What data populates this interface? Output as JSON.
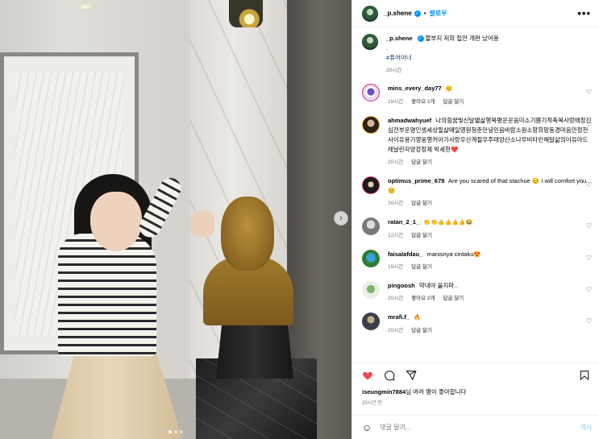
{
  "header": {
    "username": "_p.shene",
    "separator": "•",
    "follow_label": "팔로우",
    "more_label": "•••"
  },
  "caption": {
    "username": "_p.shene",
    "text": "할부지 저희 집안 개판 났어용",
    "line2": ".",
    "hashtag": "#퓨어아너",
    "time": "20시간"
  },
  "comments": [
    {
      "username": "mins_every_day77",
      "text": "🫡",
      "time": "19시간",
      "likes": "좋아요 1개",
      "reply": "답글 달기"
    },
    {
      "username": "ahmadwahyuef",
      "text": "나의힘꿈빛신달별삶행복평운운음미소기쁨기적축복사랑애정진심전부운명인생세상필살매일영원청춘안녕민음바람소원소망희망동경마음안정천사이유용기영웅행커아기사랑우산계절우주태양산소나무비타민해달삶의이유아드레날린자양강장제 박세현❤️",
      "time": "20시간",
      "likes": "",
      "reply": "답글 달기"
    },
    {
      "username": "optimus_prime_678",
      "text": "Are you scared of that stachue 😔 I will comfort you😊",
      "time": "20시간",
      "likes": "",
      "reply": "답글 달기"
    },
    {
      "username": "ratan_2_1_",
      "text": "👏👏👍👍👍👍😂",
      "time": "12시간",
      "likes": "",
      "reply": "답글 달기"
    },
    {
      "username": "faisalafdau_",
      "text": "manisnya cintaku😍",
      "time": "19시간",
      "likes": "",
      "reply": "답글 달기"
    },
    {
      "username": "pingoosh",
      "text": "막내야 울지마..",
      "time": "20시간",
      "likes": "좋아요 2개",
      "reply": "답글 달기"
    },
    {
      "username": "mrafi.f_",
      "text": "🔥",
      "time": "20시간",
      "likes": "",
      "reply": "답글 달기"
    }
  ],
  "likes": {
    "user": "iseungmin7884",
    "text": "님 여러 명이 좋아합니다"
  },
  "post_time": "20시간 전",
  "add_comment": {
    "placeholder": "댓글 달기...",
    "post_label": "게시"
  },
  "icons": {
    "heart": "heart-icon",
    "comment": "comment-icon",
    "share": "share-icon",
    "bookmark": "bookmark-icon",
    "emoji": "emoji-icon",
    "next": "chevron-right-icon"
  },
  "colors": {
    "like_red": "#ed4956",
    "link_blue": "#0095f6",
    "verified_blue": "#0095f6",
    "meta_grey": "#737373"
  }
}
